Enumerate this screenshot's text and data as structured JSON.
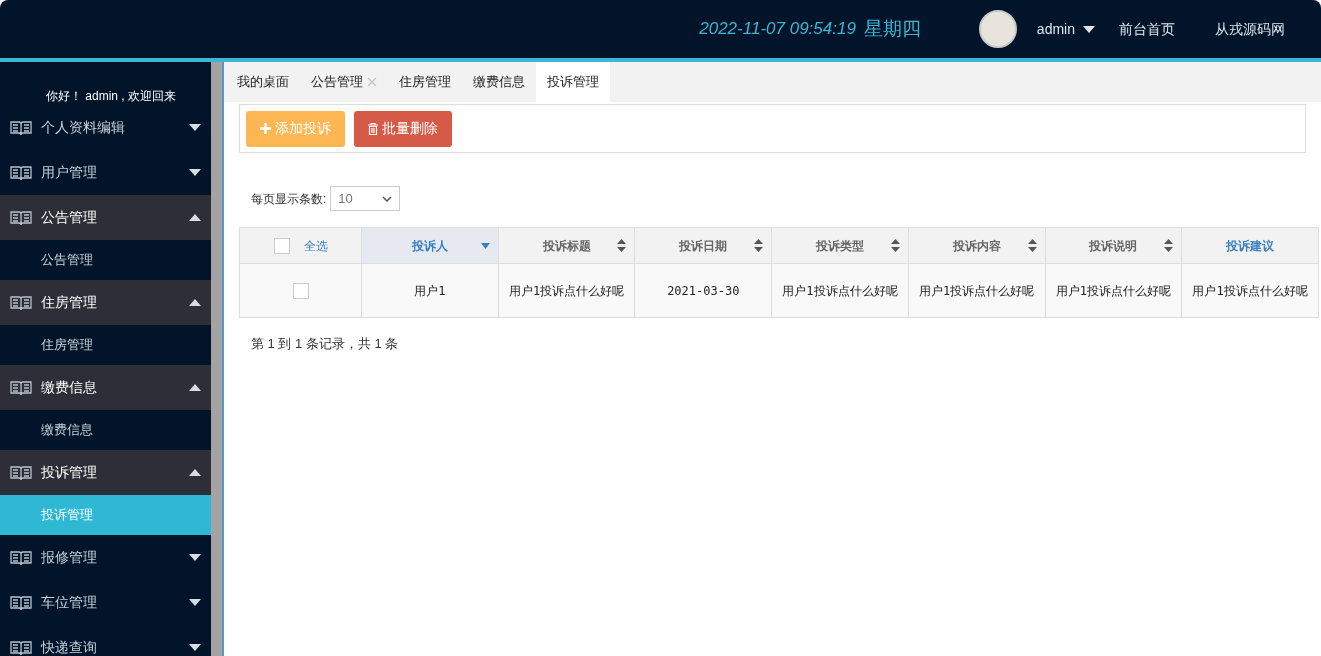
{
  "header": {
    "datetime": "2022-11-07 09:54:19",
    "weekday": "星期四",
    "user": "admin",
    "links": [
      "前台首页",
      "从戎源码网"
    ]
  },
  "sidebar": {
    "greeting": "你好！ admin , 欢迎回来",
    "items": [
      {
        "label": "个人资料编辑",
        "expanded": false
      },
      {
        "label": "用户管理",
        "expanded": false
      },
      {
        "label": "公告管理",
        "expanded": true,
        "children": [
          {
            "label": "公告管理",
            "selected": false
          }
        ]
      },
      {
        "label": "住房管理",
        "expanded": true,
        "children": [
          {
            "label": "住房管理",
            "selected": false
          }
        ]
      },
      {
        "label": "缴费信息",
        "expanded": true,
        "children": [
          {
            "label": "缴费信息",
            "selected": false
          }
        ]
      },
      {
        "label": "投诉管理",
        "expanded": true,
        "children": [
          {
            "label": "投诉管理",
            "selected": true
          }
        ]
      },
      {
        "label": "报修管理",
        "expanded": false
      },
      {
        "label": "车位管理",
        "expanded": false
      },
      {
        "label": "快递查询",
        "expanded": false
      }
    ]
  },
  "tabs": [
    {
      "label": "我的桌面",
      "selected": false,
      "closable": false
    },
    {
      "label": "公告管理",
      "selected": false,
      "closable": true
    },
    {
      "label": "住房管理",
      "selected": false,
      "closable": false
    },
    {
      "label": "缴费信息",
      "selected": false,
      "closable": false
    },
    {
      "label": "投诉管理",
      "selected": true,
      "closable": false
    }
  ],
  "toolbar": [
    {
      "label": "添加投诉",
      "kind": "add"
    },
    {
      "label": "批量删除",
      "kind": "delete"
    }
  ],
  "page_size": {
    "label": "每页显示条数:",
    "value": "10"
  },
  "table": {
    "select_all": {
      "label": "全选",
      "checked": false
    },
    "columns": [
      {
        "label": "投诉人",
        "sortable": true,
        "sorted": true
      },
      {
        "label": "投诉标题",
        "sortable": true,
        "sorted": false
      },
      {
        "label": "投诉日期",
        "sortable": true,
        "sorted": false
      },
      {
        "label": "投诉类型",
        "sortable": true,
        "sorted": false
      },
      {
        "label": "投诉内容",
        "sortable": true,
        "sorted": false
      },
      {
        "label": "投诉说明",
        "sortable": true,
        "sorted": false
      },
      {
        "label": "投诉建议",
        "sortable": false,
        "sorted": false
      }
    ],
    "rows": [
      {
        "checked": false,
        "cells": [
          "用户1",
          "用户1投诉点什么好呢",
          "2021-03-30",
          "用户1投诉点什么好呢",
          "用户1投诉点什么好呢",
          "用户1投诉点什么好呢",
          "用户1投诉点什么好呢"
        ]
      }
    ]
  },
  "record_summary": "第 1 到 1 条记录，共 1 条"
}
